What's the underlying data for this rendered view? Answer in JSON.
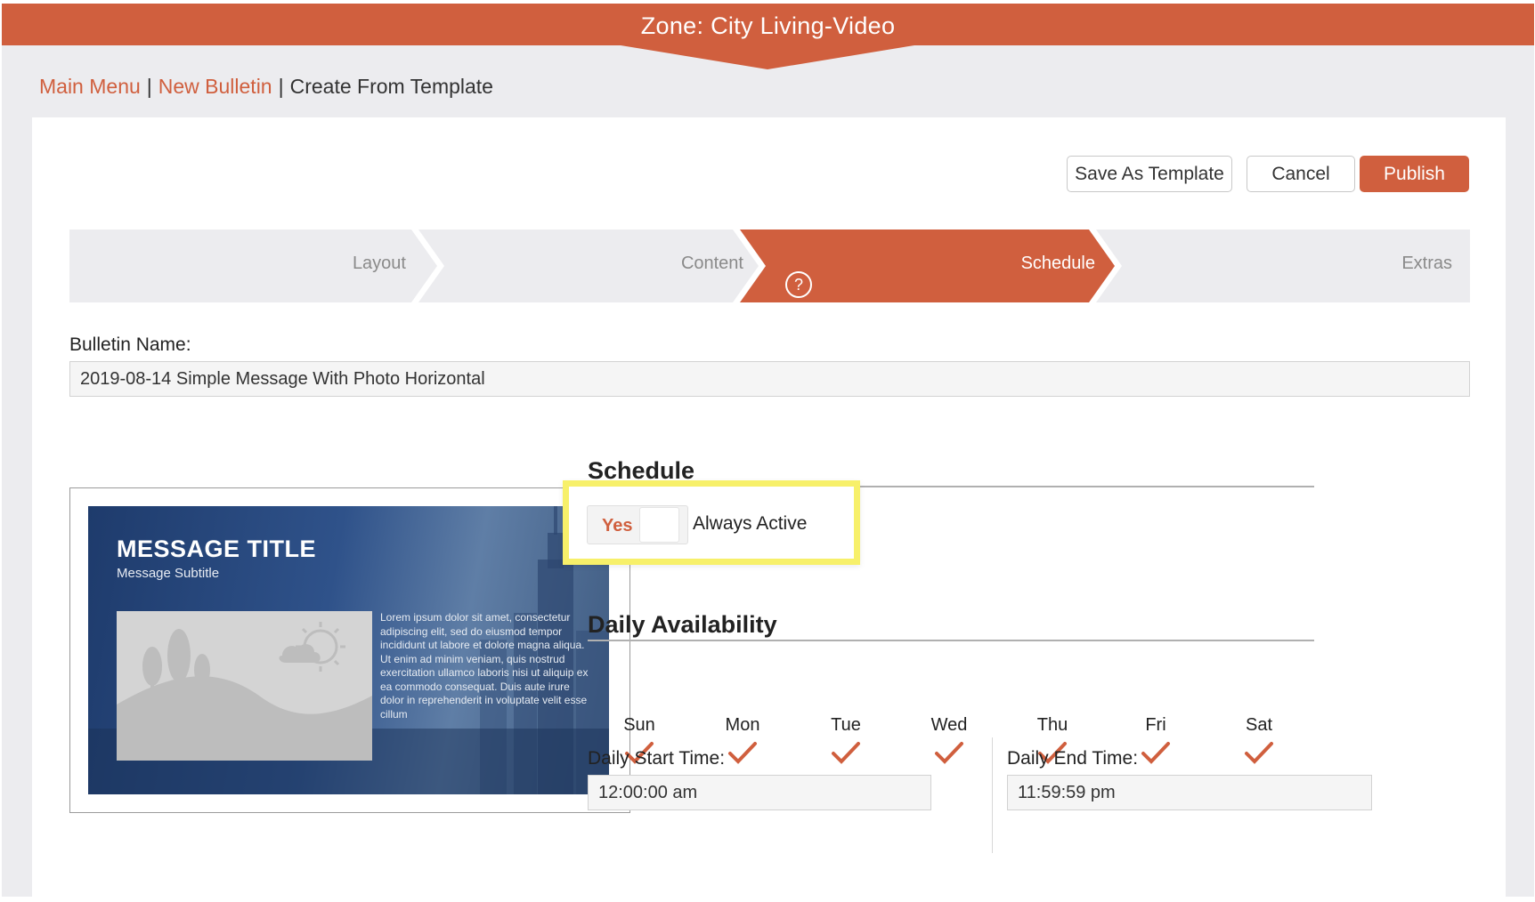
{
  "banner": {
    "title": "Zone: City Living-Video"
  },
  "breadcrumb": {
    "main_menu": "Main Menu",
    "separator": "|",
    "new_bulletin": "New Bulletin",
    "current": "Create From Template"
  },
  "actions": {
    "save_template": "Save As Template",
    "cancel": "Cancel",
    "publish": "Publish"
  },
  "steps": [
    {
      "label": "Layout",
      "state": "inactive"
    },
    {
      "label": "Content",
      "state": "inactive"
    },
    {
      "label": "Schedule",
      "state": "active"
    },
    {
      "label": "Extras",
      "state": "inactive"
    }
  ],
  "help_glyph": "?",
  "bulletin": {
    "label": "Bulletin Name:",
    "value": "2019-08-14 Simple Message With Photo Horizontal"
  },
  "preview": {
    "title": "MESSAGE TITLE",
    "subtitle": "Message Subtitle",
    "body": "Lorem ipsum dolor sit amet, consectetur adipiscing elit, sed do eiusmod tempor incididunt ut labore et dolore magna aliqua. Ut enim ad minim veniam, quis nostrud exercitation ullamco laboris nisi ut aliquip ex ea commodo consequat. Duis aute irure dolor in reprehenderit in voluptate velit esse cillum"
  },
  "schedule": {
    "title": "Schedule",
    "toggle_value": "Yes",
    "toggle_label": "Always Active"
  },
  "daily": {
    "title": "Daily Availability",
    "days": [
      {
        "label": "Sun",
        "checked": true
      },
      {
        "label": "Mon",
        "checked": true
      },
      {
        "label": "Tue",
        "checked": true
      },
      {
        "label": "Wed",
        "checked": true
      },
      {
        "label": "Thu",
        "checked": true
      },
      {
        "label": "Fri",
        "checked": true
      },
      {
        "label": "Sat",
        "checked": true
      }
    ],
    "start_label": "Daily Start Time:",
    "start_value": "12:00:00 am",
    "end_label": "Daily End Time:",
    "end_value": "11:59:59 pm"
  },
  "colors": {
    "accent": "#d05f3e",
    "highlight": "#f7f06a",
    "step_inactive": "#ececef"
  }
}
